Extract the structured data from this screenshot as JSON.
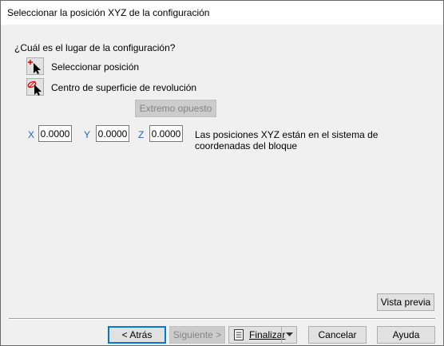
{
  "window": {
    "title": "Seleccionar la posición XYZ de la configuración"
  },
  "prompt": "¿Cuál es el lugar de la configuración?",
  "options": [
    {
      "label": "Seleccionar posición",
      "icon": "pick-point-icon"
    },
    {
      "label": "Centro de superficie de revolución",
      "icon": "surface-center-icon"
    }
  ],
  "opposite_end_button": "Extremo opuesto",
  "coords": {
    "x_label": "X",
    "x_value": "0.0000",
    "y_label": "Y",
    "y_value": "0.0000",
    "z_label": "Z",
    "z_value": "0.0000"
  },
  "coords_note": "Las posiciones XYZ están en el sistema de coordenadas del bloque",
  "preview_button": "Vista previa",
  "footer": {
    "back": "< Atrás",
    "next": "Siguiente >",
    "finish": "Finalizar",
    "cancel": "Cancelar",
    "help": "Ayuda"
  },
  "colors": {
    "accent": "#0078d7",
    "axis_label": "#1e64b4",
    "disabled_text": "#838383"
  }
}
